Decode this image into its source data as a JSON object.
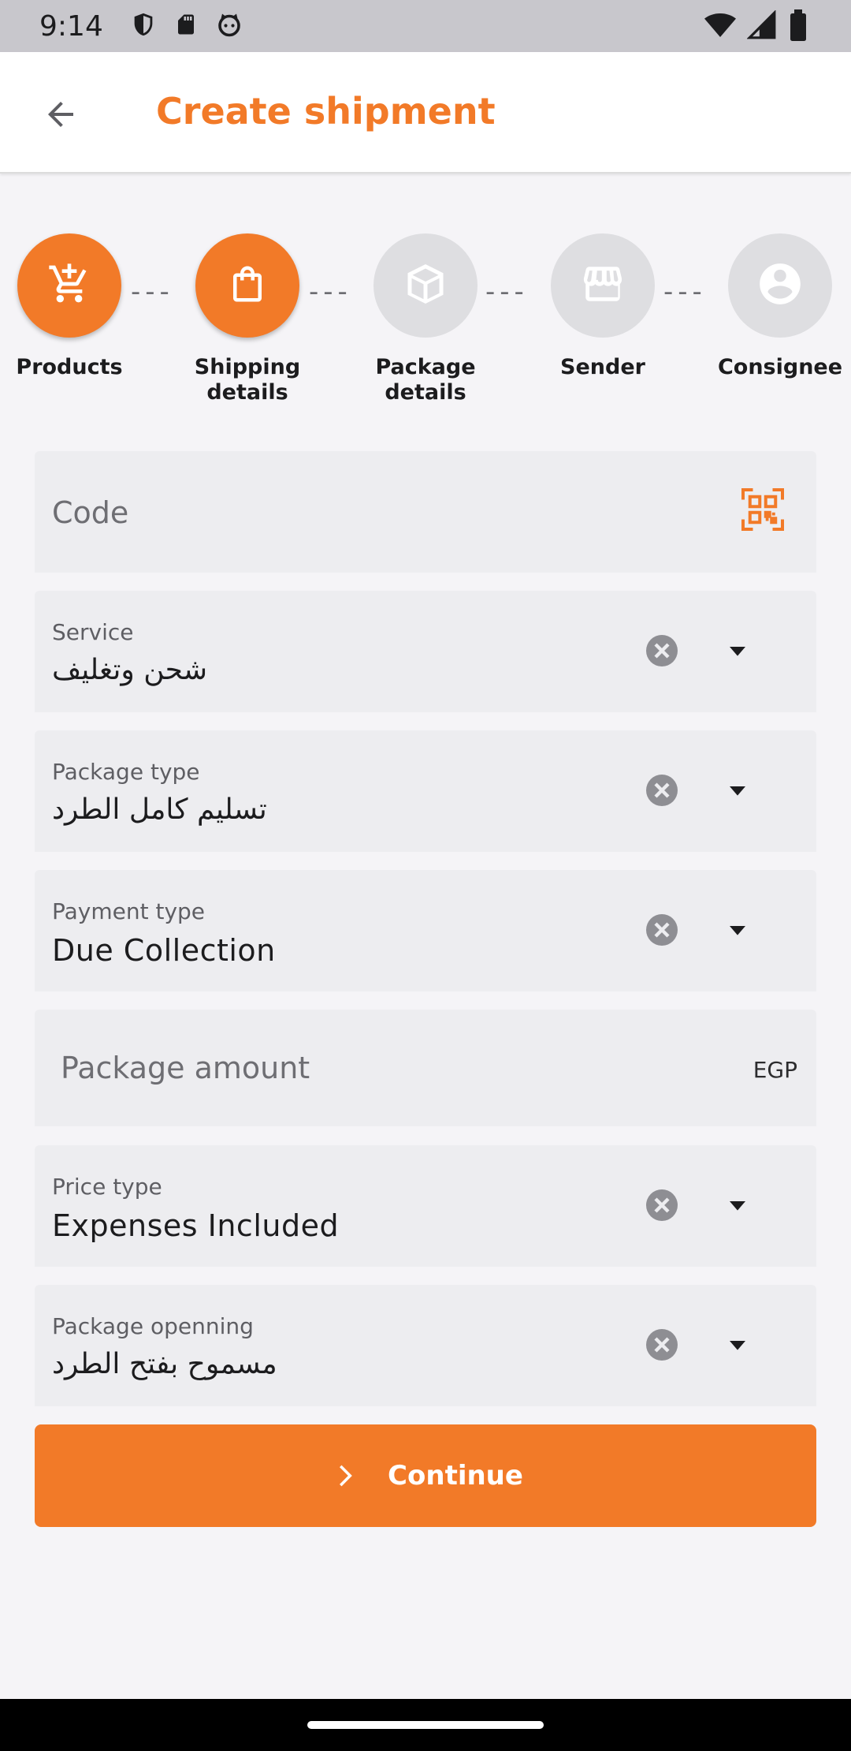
{
  "status_bar": {
    "time": "9:14",
    "icons": [
      "shield-icon",
      "sd-card-icon",
      "cat-icon",
      "wifi-icon",
      "signal-icon",
      "battery-icon"
    ]
  },
  "app_bar": {
    "title": "Create shipment",
    "back_icon": "arrow-left-icon"
  },
  "colors": {
    "accent": "#f27a28",
    "inactive_step": "#dedee1",
    "field_bg": "#ededf0"
  },
  "stepper": {
    "steps": [
      {
        "label": "Products",
        "icon": "cart-plus-icon",
        "state": "active"
      },
      {
        "label": "Shipping details",
        "icon": "shopping-bag-icon",
        "state": "active"
      },
      {
        "label": "Package details",
        "icon": "box-icon",
        "state": "inactive"
      },
      {
        "label": "Sender",
        "icon": "storefront-icon",
        "state": "inactive"
      },
      {
        "label": "Consignee",
        "icon": "account-circle-icon",
        "state": "inactive"
      }
    ],
    "separator": "---"
  },
  "form": {
    "code": {
      "placeholder": "Code",
      "icon": "qr-code-scan-icon"
    },
    "service": {
      "label": "Service",
      "value": "شحن وتغليف"
    },
    "package_type": {
      "label": "Package type",
      "value": "تسليم كامل الطرد"
    },
    "payment_type": {
      "label": "Payment type",
      "value": "Due Collection"
    },
    "package_amount": {
      "placeholder": "Package amount",
      "suffix": "EGP"
    },
    "price_type": {
      "label": "Price type",
      "value": "Expenses Included"
    },
    "package_opening": {
      "label": "Package openning",
      "value": "مسموح بفتح الطرد"
    }
  },
  "continue_button": {
    "label": "Continue",
    "icon": "chevron-right-icon"
  }
}
